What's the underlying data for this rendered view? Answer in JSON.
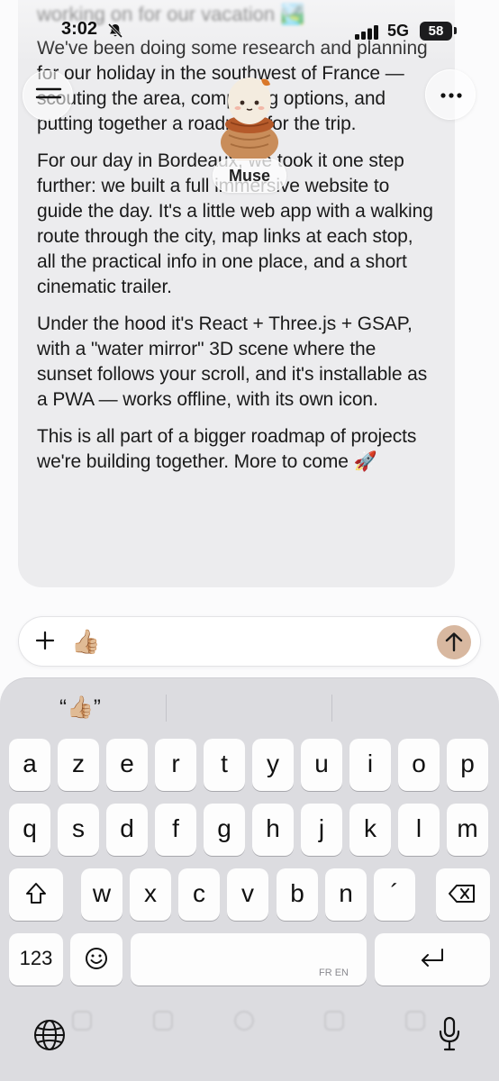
{
  "status_bar": {
    "time": "3:02",
    "network": "5G",
    "battery": "58"
  },
  "header": {
    "assistant_name": "Muse"
  },
  "message": {
    "peek_line": "working on for our vacation 🏞️",
    "paragraphs": [
      "We've been doing some research and planning for our holiday in the southwest of France — scouting the area, comparing options, and putting together a roadmap for the trip.",
      "For our day in Bordeaux, we took it one step further: we built a full immersive website to guide the day. It's a little web app with a walking route through the city, map links at each stop, all the practical info in one place, and a short cinematic trailer.",
      "Under the hood it's React + Three.js + GSAP, with a \"water mirror\" 3D scene where the sunset follows your scroll, and it's installable as a PWA — works offline, with its own icon.",
      "This is all part of a bigger roadmap of projects we're building together. More to come 🚀"
    ]
  },
  "composer": {
    "value": "👍🏼"
  },
  "keyboard": {
    "suggestion": "“👍🏼”",
    "row1": [
      "a",
      "z",
      "e",
      "r",
      "t",
      "y",
      "u",
      "i",
      "o",
      "p"
    ],
    "row2": [
      "q",
      "s",
      "d",
      "f",
      "g",
      "h",
      "j",
      "k",
      "l",
      "m"
    ],
    "row3": [
      "w",
      "x",
      "c",
      "v",
      "b",
      "n",
      "´"
    ],
    "numbers_label": "123",
    "space_languages": "FR EN"
  },
  "colors": {
    "bubble": "#ececee",
    "send_button": "#d8b8a0",
    "keyboard_bg": "#dcdce0"
  },
  "icons": [
    "menu-icon",
    "more-icon",
    "bell-slash-icon",
    "signal-icon",
    "plus-icon",
    "send-arrow-icon",
    "shift-icon",
    "backspace-icon",
    "emoji-icon",
    "return-icon",
    "globe-icon",
    "mic-icon"
  ]
}
